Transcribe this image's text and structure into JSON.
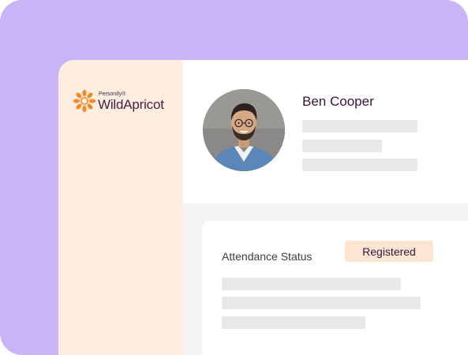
{
  "brand": {
    "small_text": "Personify®",
    "name": "WildApricot",
    "accent_color": "#f58a2b",
    "text_color": "#4a1f3d"
  },
  "profile": {
    "name": "Ben Cooper",
    "avatar_icon": "person-avatar-icon"
  },
  "attendance": {
    "label": "Attendance Status",
    "status": "Registered"
  },
  "colors": {
    "backdrop": "#c9b5f5",
    "sidebar": "#fdeee0",
    "badge": "#fde6d4",
    "placeholder": "#e8e8ea"
  }
}
